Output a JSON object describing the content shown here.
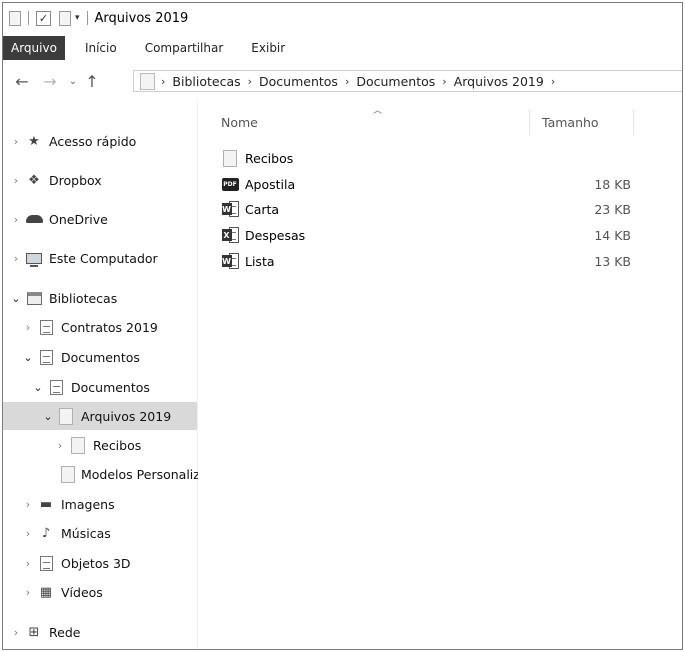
{
  "window": {
    "title": "Arquivos 2019"
  },
  "ribbon": {
    "tabs": [
      "Arquivo",
      "Início",
      "Compartilhar",
      "Exibir"
    ]
  },
  "nav": {
    "back": "←",
    "forward": "→",
    "recent": "⌄",
    "up": "↑",
    "breadcrumb": [
      "Bibliotecas",
      "Documentos",
      "Documentos",
      "Arquivos 2019"
    ],
    "chevron": "›"
  },
  "tree": [
    {
      "label": "Acesso rápido"
    },
    {
      "label": "Dropbox"
    },
    {
      "label": "OneDrive"
    },
    {
      "label": "Este Computador"
    },
    {
      "label": "Bibliotecas"
    },
    {
      "label": "Contratos 2019"
    },
    {
      "label": "Documentos"
    },
    {
      "label": "Documentos"
    },
    {
      "label": "Arquivos 2019"
    },
    {
      "label": "Recibos"
    },
    {
      "label": "Modelos Personalizados"
    },
    {
      "label": "Imagens"
    },
    {
      "label": "Músicas"
    },
    {
      "label": "Objetos 3D"
    },
    {
      "label": "Vídeos"
    },
    {
      "label": "Rede"
    }
  ],
  "columns": {
    "name": "Nome",
    "size": "Tamanho"
  },
  "files": [
    {
      "name": "Recibos",
      "size": "",
      "icon": "folder-icon"
    },
    {
      "name": "Apostila",
      "size": "18 KB",
      "icon": "pdf-icon",
      "badge": "PDF"
    },
    {
      "name": "Carta",
      "size": "23 KB",
      "icon": "word-icon",
      "badge": "W"
    },
    {
      "name": "Despesas",
      "size": "14 KB",
      "icon": "spreadsheet-icon",
      "badge": "X"
    },
    {
      "name": "Lista",
      "size": "13 KB",
      "icon": "word-icon",
      "badge": "W"
    }
  ]
}
